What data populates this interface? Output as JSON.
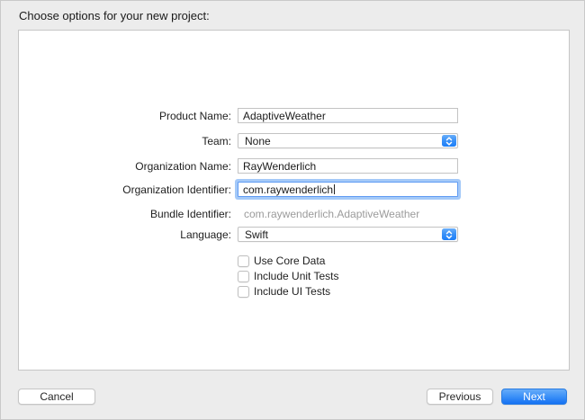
{
  "window": {
    "title": "Choose options for your new project:"
  },
  "form": {
    "rows": [
      {
        "label": "Product Name:",
        "value": "AdaptiveWeather",
        "type": "text"
      },
      {
        "label": "Team:",
        "value": "None",
        "type": "select"
      },
      {
        "label": "Organization Name:",
        "value": "RayWenderlich",
        "type": "text"
      },
      {
        "label": "Organization Identifier:",
        "value": "com.raywenderlich",
        "type": "text",
        "focused": true
      },
      {
        "label": "Bundle Identifier:",
        "value": "com.raywenderlich.AdaptiveWeather",
        "type": "static"
      },
      {
        "label": "Language:",
        "value": "Swift",
        "type": "select"
      }
    ],
    "checkboxes": [
      {
        "label": "Use Core Data",
        "checked": false
      },
      {
        "label": "Include Unit Tests",
        "checked": false
      },
      {
        "label": "Include UI Tests",
        "checked": false
      }
    ]
  },
  "footer": {
    "cancel_label": "Cancel",
    "previous_label": "Previous",
    "next_label": "Next"
  },
  "colors": {
    "accent_blue": "#1c7ef8",
    "focus_ring": "#a4c9f8",
    "window_background": "#ececec"
  }
}
